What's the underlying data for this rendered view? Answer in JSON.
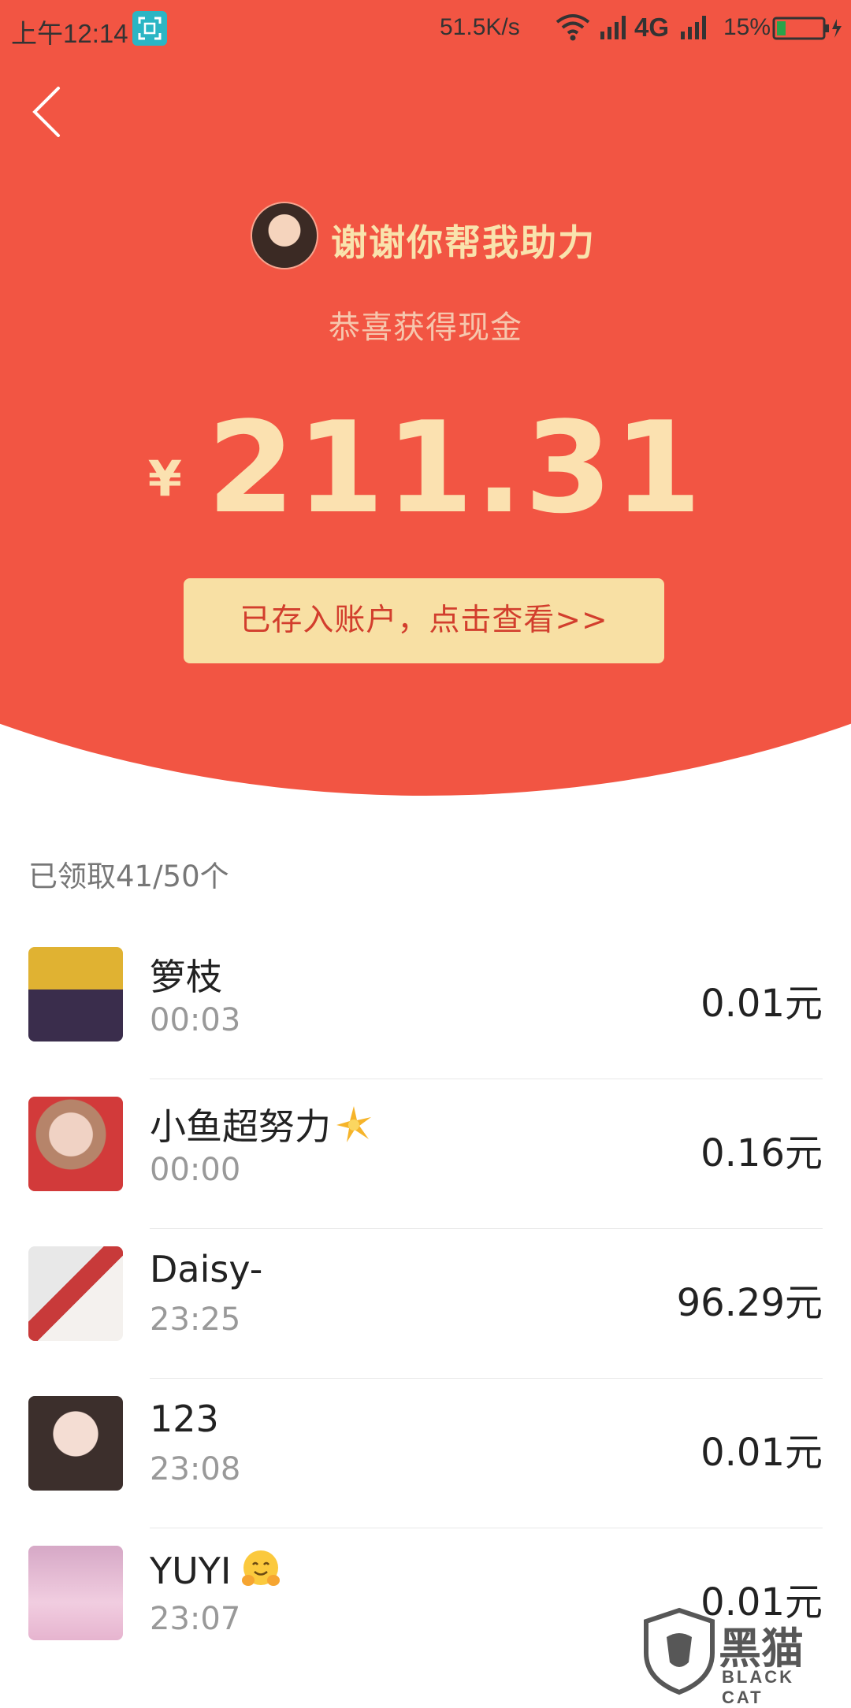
{
  "status_bar": {
    "time": "上午12:14",
    "net_speed": "51.5K/s",
    "network_type": "4G",
    "battery": "15%"
  },
  "header": {
    "thanks": "谢谢你帮我助力",
    "congrats": "恭喜获得现金",
    "currency": "¥",
    "amount": "211.31",
    "deposit_button": "已存入账户，点击查看>>"
  },
  "list": {
    "count_label": "已领取41/50个",
    "items": [
      {
        "name": "箩枝",
        "time": "00:03",
        "value": "0.01元"
      },
      {
        "name": "小鱼超努力",
        "time": "00:00",
        "value": "0.16元"
      },
      {
        "name": "Daisy-",
        "time": "23:25",
        "value": "96.29元"
      },
      {
        "name": "123",
        "time": "23:08",
        "value": "0.01元"
      },
      {
        "name": "YUYI",
        "time": "23:07",
        "value": "0.01元"
      }
    ]
  },
  "watermark": {
    "title": "黑猫",
    "subtitle": "BLACK CAT"
  },
  "colors": {
    "header_red": "#f25543",
    "gold_text": "#fbe1b0",
    "button_bg": "#f8e0a4",
    "button_text": "#d23e2d"
  }
}
